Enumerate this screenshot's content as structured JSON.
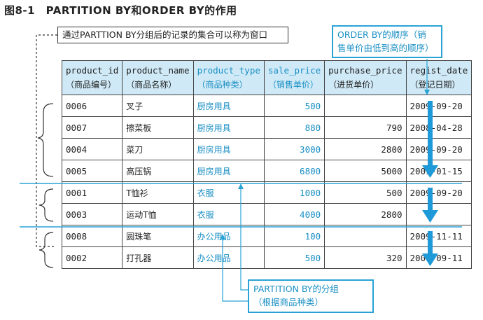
{
  "figure": {
    "title": "图8-1　PARTITION BY和ORDER BY的作用",
    "note_window": "通过PARTTION BY分组后的记录的集合可以称为窗口",
    "note_order": [
      "ORDER BY的顺序（销",
      "售单价由低到高的顺序）"
    ],
    "note_partition": [
      "PARTITION BY的分组",
      "（根据商品种类）"
    ]
  },
  "table": {
    "columns": [
      {
        "name": "product_id",
        "label": "（商品编号）"
      },
      {
        "name": "product_name",
        "label": "（商品名称）"
      },
      {
        "name": "product_type",
        "label": "（商品种类）"
      },
      {
        "name": "sale_price",
        "label": "（销售单价）"
      },
      {
        "name": "purchase_price",
        "label": "（进货单价）"
      },
      {
        "name": "regist_date",
        "label": "（登记日期）"
      }
    ],
    "rows": [
      [
        "0006",
        "叉子",
        "厨房用具",
        "500",
        "",
        "2009-09-20"
      ],
      [
        "0007",
        "擦菜板",
        "厨房用具",
        "880",
        "790",
        "2008-04-28"
      ],
      [
        "0004",
        "菜刀",
        "厨房用具",
        "3000",
        "2800",
        "2009-09-20"
      ],
      [
        "0005",
        "高压锅",
        "厨房用具",
        "6800",
        "5000",
        "2009-01-15"
      ],
      [
        "0001",
        "T恤衫",
        "衣服",
        "1000",
        "500",
        "2009-09-20"
      ],
      [
        "0003",
        "运动T恤",
        "衣服",
        "4000",
        "2800",
        ""
      ],
      [
        "0008",
        "圆珠笔",
        "办公用品",
        "100",
        "",
        "2009-11-11"
      ],
      [
        "0002",
        "打孔器",
        "办公用品",
        "500",
        "320",
        "2009-09-11"
      ]
    ]
  },
  "colors": {
    "accent": "#1a8fc4",
    "header_bg": "#cfe9f6",
    "arrow": "#1e9ad8"
  }
}
